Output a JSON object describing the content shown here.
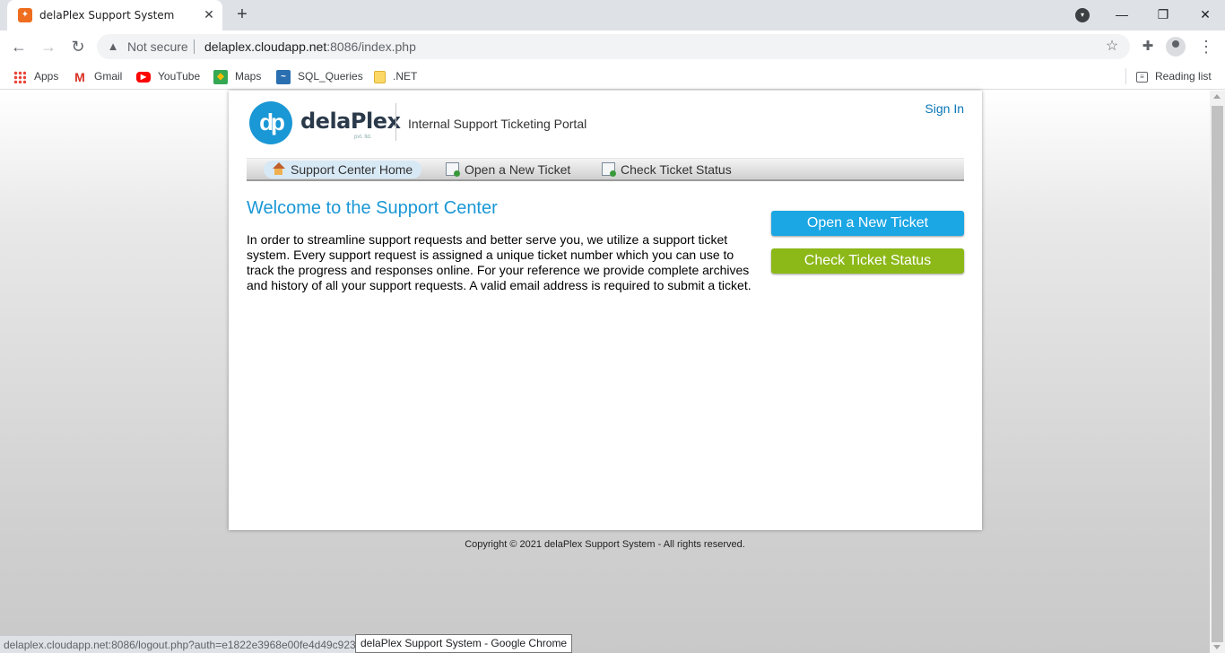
{
  "browser": {
    "tab_title": "delaPlex Support System",
    "new_tab_label": "+",
    "security_label": "Not secure",
    "url_host": "delaplex.cloudapp.net",
    "url_rest": ":8086/index.php",
    "status_url": "delaplex.cloudapp.net:8086/logout.php?auth=e1822e3968e00fe4d49c923",
    "tooltip": "delaPlex Support System - Google Chrome"
  },
  "bookmarks": {
    "items": [
      {
        "label": "Apps",
        "icon": "apps-grid-icon"
      },
      {
        "label": "Gmail",
        "icon": "gmail-icon"
      },
      {
        "label": "YouTube",
        "icon": "youtube-icon"
      },
      {
        "label": "Maps",
        "icon": "maps-icon"
      },
      {
        "label": "SQL_Queries",
        "icon": "sql-queries-icon"
      },
      {
        "label": ".NET",
        "icon": "folder-icon"
      }
    ],
    "reading_list": "Reading list"
  },
  "header": {
    "logo_mark": "dp",
    "logo_text": "delaPlex",
    "logo_sub": "pvt. ltd.",
    "portal_title": "Internal Support Ticketing Portal",
    "signin": "Sign In"
  },
  "nav": {
    "items": [
      {
        "label": "Support Center Home",
        "icon": "home-icon"
      },
      {
        "label": "Open a New Ticket",
        "icon": "new-ticket-icon"
      },
      {
        "label": "Check Ticket Status",
        "icon": "ticket-status-icon"
      }
    ]
  },
  "main": {
    "welcome": "Welcome to the Support Center",
    "intro": "In order to streamline support requests and better serve you, we utilize a support ticket system. Every support request is assigned a unique ticket number which you can use to track the progress and responses online. For your reference we provide complete archives and history of all your support requests. A valid email address is required to submit a ticket.",
    "open_ticket_btn": "Open a New Ticket",
    "check_status_btn": "Check Ticket Status"
  },
  "footer": {
    "copyright": "Copyright © 2021 delaPlex Support System - All rights reserved."
  },
  "colors": {
    "brand_blue": "#1a97d5",
    "open_btn": "#1ba6e4",
    "check_btn": "#8cb818"
  }
}
